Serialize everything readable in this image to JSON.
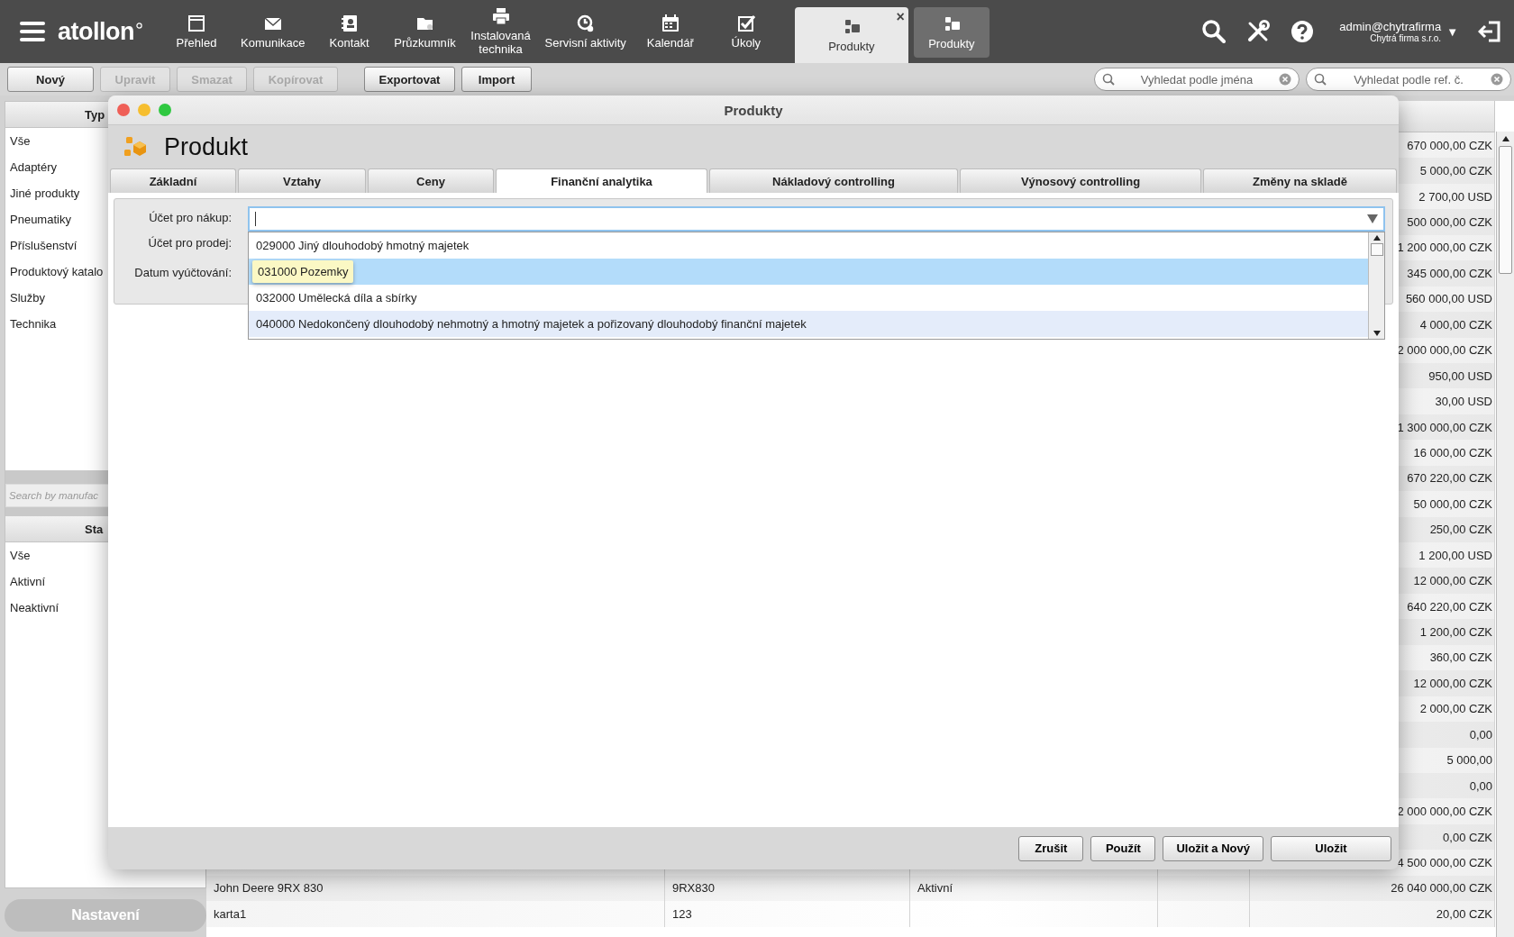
{
  "topbar": {
    "logo": "atollon",
    "nav": [
      {
        "label": "Přehled",
        "kind": "window",
        "selected": false,
        "open": false
      },
      {
        "label": "Komunikace",
        "kind": "envelope",
        "selected": false,
        "open": false
      },
      {
        "label": "Kontakt",
        "kind": "contact",
        "selected": false,
        "open": false
      },
      {
        "label": "Průzkumník",
        "kind": "folder",
        "selected": false,
        "open": false
      },
      {
        "label": "Instalovaná\ntechnika",
        "kind": "printer",
        "selected": false,
        "open": false
      },
      {
        "label": "Servisní aktivity",
        "kind": "service",
        "selected": false,
        "open": false
      },
      {
        "label": "Kalendář",
        "kind": "calendar",
        "selected": false,
        "open": false
      },
      {
        "label": "Úkoly",
        "kind": "check",
        "selected": false,
        "open": false
      },
      {
        "label": "Produkty",
        "kind": "boxes",
        "selected": true,
        "open": true,
        "close": "×"
      },
      {
        "label": "Produkty",
        "kind": "boxes",
        "selected": false,
        "open": true
      }
    ],
    "user": {
      "name": "admin@chytrafirma",
      "company": "Chytrá firma s.r.o.",
      "caret": "▼"
    }
  },
  "toolbar": {
    "buttons": [
      {
        "label": "Nový",
        "disabled": false
      },
      {
        "label": "Upravit",
        "disabled": true
      },
      {
        "label": "Smazat",
        "disabled": true
      },
      {
        "label": "Kopírovat",
        "disabled": true
      },
      {
        "label": "Exportovat",
        "disabled": false
      },
      {
        "label": "Import",
        "disabled": false
      }
    ],
    "searches": [
      {
        "placeholder": "Vyhledat podle jména"
      },
      {
        "placeholder": "Vyhledat podle ref. č."
      }
    ]
  },
  "sidebar": {
    "type_header": "Typ",
    "type_items": [
      "Vše",
      "Adaptéry",
      "Jiné produkty",
      "Pneumatiky",
      "Příslušenství",
      "Produktový katalo",
      "Služby",
      "Technika"
    ],
    "search": {
      "placeholder": "Search by manufac"
    },
    "status_header": "Sta",
    "status_items": [
      "Vše",
      "Aktivní",
      "Neaktivní"
    ],
    "settings_button": "Nastavení"
  },
  "table": {
    "rows": [
      {
        "amount": "670 000,00 CZK"
      },
      {
        "amount": "5 000,00 CZK"
      },
      {
        "amount": "2 700,00 USD"
      },
      {
        "amount": "500 000,00 CZK"
      },
      {
        "amount": "1 200 000,00 CZK"
      },
      {
        "amount": "345 000,00 CZK"
      },
      {
        "amount": "560 000,00 USD"
      },
      {
        "amount": "4 000,00 CZK"
      },
      {
        "amount": "2 000 000,00 CZK"
      },
      {
        "amount": "950,00 USD"
      },
      {
        "amount": "30,00 USD"
      },
      {
        "amount": "1 300 000,00 CZK"
      },
      {
        "amount": "16 000,00 CZK"
      },
      {
        "amount": "670 220,00 CZK"
      },
      {
        "amount": "50 000,00 CZK"
      },
      {
        "amount": "250,00 CZK"
      },
      {
        "amount": "1 200,00 USD"
      },
      {
        "amount": "12 000,00 CZK"
      },
      {
        "amount": "640 220,00 CZK"
      },
      {
        "amount": "1 200,00 CZK"
      },
      {
        "amount": "360,00 CZK"
      },
      {
        "amount": "12 000,00 CZK"
      },
      {
        "amount": "2 000,00 CZK"
      },
      {
        "amount": "0,00"
      },
      {
        "amount": "5 000,00"
      },
      {
        "amount": "0,00"
      },
      {
        "amount": "2 000 000,00 CZK"
      },
      {
        "amount": "0,00 CZK"
      },
      {
        "amount": "4 500 000,00 CZK"
      },
      {
        "name": "John Deere 9RX 830",
        "code": "9RX830",
        "status": "Aktivní",
        "amount": "26 040 000,00 CZK"
      },
      {
        "name": "karta1",
        "code": "123",
        "amount": "20,00 CZK"
      }
    ]
  },
  "dialog": {
    "title": "Produkty",
    "heading": "Produkt",
    "tabs": [
      {
        "label": "Základní",
        "selected": false
      },
      {
        "label": "Vztahy",
        "selected": false
      },
      {
        "label": "Ceny",
        "selected": false
      },
      {
        "label": "Finanční analytika",
        "selected": true
      },
      {
        "label": "Nákladový controlling",
        "selected": false
      },
      {
        "label": "Výnosový controlling",
        "selected": false
      },
      {
        "label": "Změny na skladě",
        "selected": false
      }
    ],
    "fields": [
      "Účet pro nákup:",
      "Účet pro prodej:",
      "Datum vyúčtování:"
    ],
    "combo": {
      "focused": true,
      "open": true,
      "items": [
        {
          "label": "029000 Jiný dlouhodobý hmotný majetek",
          "selected": false,
          "hovered": false,
          "tooltip": false
        },
        {
          "label": "031000 Pozemky",
          "selected": true,
          "hovered": false,
          "tooltip": true
        },
        {
          "label": "032000 Umělecká díla a sbírky",
          "selected": false,
          "hovered": false,
          "tooltip": false
        },
        {
          "label": "040000 Nedokončený dlouhodobý nehmotný a hmotný majetek a pořizovaný dlouhodobý finanční majetek",
          "selected": false,
          "hovered": true,
          "tooltip": false
        }
      ]
    },
    "buttons": [
      "Zrušit",
      "Použít",
      "Uložit a Nový",
      "Uložit"
    ]
  }
}
